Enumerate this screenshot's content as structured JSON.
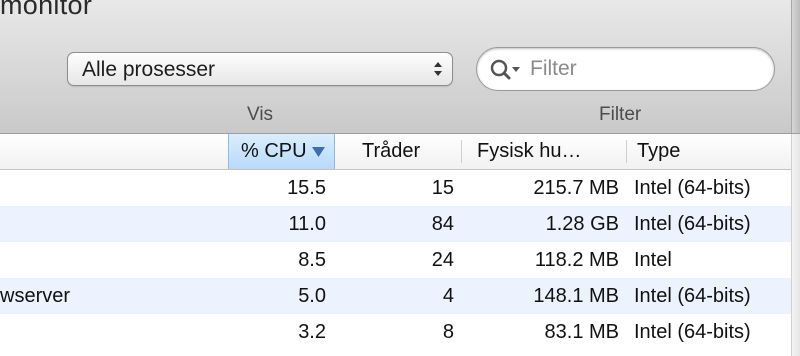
{
  "window": {
    "title_partial": "monitor"
  },
  "toolbar": {
    "view_select": {
      "value": "Alle prosesser",
      "caption": "Vis"
    },
    "search": {
      "placeholder": "Filter",
      "caption": "Filter"
    }
  },
  "table": {
    "columns": [
      {
        "id": "cpu",
        "label": "% CPU",
        "sorted": "descending"
      },
      {
        "id": "threads",
        "label": "Tråder"
      },
      {
        "id": "memory",
        "label": "Fysisk hu…"
      },
      {
        "id": "type",
        "label": "Type"
      }
    ],
    "rows": [
      {
        "name": "",
        "cpu": "15.5",
        "threads": "15",
        "memory": "215.7 MB",
        "type": "Intel (64-bits)"
      },
      {
        "name": "",
        "cpu": "11.0",
        "threads": "84",
        "memory": "1.28 GB",
        "type": "Intel (64-bits)"
      },
      {
        "name": "",
        "cpu": "8.5",
        "threads": "24",
        "memory": "118.2 MB",
        "type": "Intel"
      },
      {
        "name": "wserver",
        "cpu": "5.0",
        "threads": "4",
        "memory": "148.1 MB",
        "type": "Intel (64-bits)"
      },
      {
        "name": "",
        "cpu": "3.2",
        "threads": "8",
        "memory": "83.1 MB",
        "type": "Intel (64-bits)"
      }
    ]
  },
  "colors": {
    "sorted_header": "#b8dafa",
    "alt_row": "#edf3fe",
    "sort_arrow": "#3d6fb0"
  }
}
